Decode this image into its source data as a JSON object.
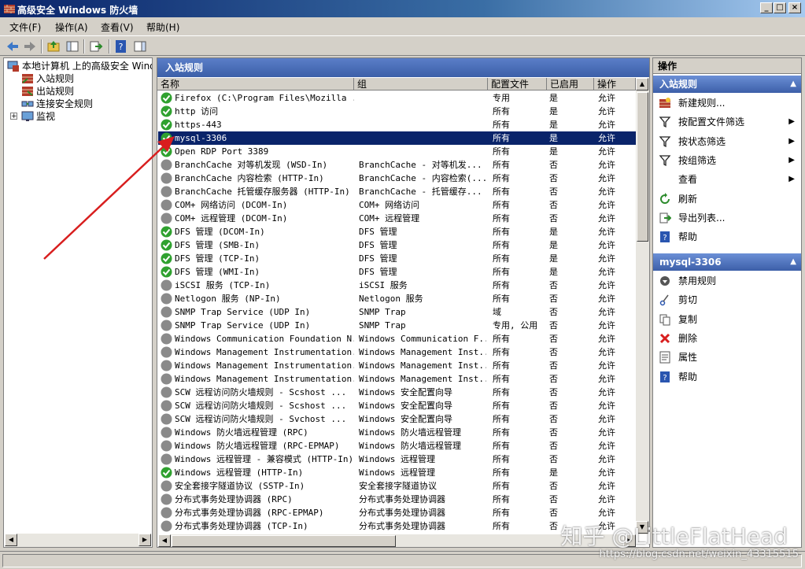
{
  "window": {
    "title": "高级安全 Windows 防火墙",
    "min_glyph": "_",
    "max_glyph": "□",
    "close_glyph": "×"
  },
  "menu": [
    "文件(F)",
    "操作(A)",
    "查看(V)",
    "帮助(H)"
  ],
  "tree": {
    "root": "本地计算机 上的高级安全 Windows 防火墙",
    "items": [
      "入站规则",
      "出站规则",
      "连接安全规则",
      "监视"
    ]
  },
  "center": {
    "header": "入站规则",
    "columns": [
      "名称",
      "组",
      "配置文件",
      "已启用",
      "操作"
    ],
    "rows": [
      {
        "name": "Firefox (C:\\Program Files\\Mozilla ...",
        "group": "",
        "profile": "专用",
        "enabled": "是",
        "action": "允许",
        "on": true
      },
      {
        "name": "http 访问",
        "group": "",
        "profile": "所有",
        "enabled": "是",
        "action": "允许",
        "on": true
      },
      {
        "name": "https-443",
        "group": "",
        "profile": "所有",
        "enabled": "是",
        "action": "允许",
        "on": true
      },
      {
        "name": "mysql-3306",
        "group": "",
        "profile": "所有",
        "enabled": "是",
        "action": "允许",
        "on": true,
        "selected": true
      },
      {
        "name": "Open RDP Port 3389",
        "group": "",
        "profile": "所有",
        "enabled": "是",
        "action": "允许",
        "on": true
      },
      {
        "name": "BranchCache 对等机发现 (WSD-In)",
        "group": "BranchCache - 对等机发...",
        "profile": "所有",
        "enabled": "否",
        "action": "允许",
        "on": false
      },
      {
        "name": "BranchCache 内容检索 (HTTP-In)",
        "group": "BranchCache - 内容检索(...",
        "profile": "所有",
        "enabled": "否",
        "action": "允许",
        "on": false
      },
      {
        "name": "BranchCache 托管缓存服务器 (HTTP-In)",
        "group": "BranchCache - 托管缓存...",
        "profile": "所有",
        "enabled": "否",
        "action": "允许",
        "on": false
      },
      {
        "name": "COM+ 网络访问 (DCOM-In)",
        "group": "COM+ 网络访问",
        "profile": "所有",
        "enabled": "否",
        "action": "允许",
        "on": false
      },
      {
        "name": "COM+ 远程管理 (DCOM-In)",
        "group": "COM+ 远程管理",
        "profile": "所有",
        "enabled": "否",
        "action": "允许",
        "on": false
      },
      {
        "name": "DFS 管理 (DCOM-In)",
        "group": "DFS 管理",
        "profile": "所有",
        "enabled": "是",
        "action": "允许",
        "on": true
      },
      {
        "name": "DFS 管理 (SMB-In)",
        "group": "DFS 管理",
        "profile": "所有",
        "enabled": "是",
        "action": "允许",
        "on": true
      },
      {
        "name": "DFS 管理 (TCP-In)",
        "group": "DFS 管理",
        "profile": "所有",
        "enabled": "是",
        "action": "允许",
        "on": true
      },
      {
        "name": "DFS 管理 (WMI-In)",
        "group": "DFS 管理",
        "profile": "所有",
        "enabled": "是",
        "action": "允许",
        "on": true
      },
      {
        "name": "iSCSI 服务 (TCP-In)",
        "group": "iSCSI 服务",
        "profile": "所有",
        "enabled": "否",
        "action": "允许",
        "on": false
      },
      {
        "name": "Netlogon 服务 (NP-In)",
        "group": "Netlogon 服务",
        "profile": "所有",
        "enabled": "否",
        "action": "允许",
        "on": false
      },
      {
        "name": "SNMP Trap Service (UDP In)",
        "group": "SNMP Trap",
        "profile": "域",
        "enabled": "否",
        "action": "允许",
        "on": false
      },
      {
        "name": "SNMP Trap Service (UDP In)",
        "group": "SNMP Trap",
        "profile": "专用, 公用",
        "enabled": "否",
        "action": "允许",
        "on": false
      },
      {
        "name": "Windows Communication Foundation N...",
        "group": "Windows Communication F...",
        "profile": "所有",
        "enabled": "否",
        "action": "允许",
        "on": false
      },
      {
        "name": "Windows Management Instrumentation...",
        "group": "Windows Management Inst...",
        "profile": "所有",
        "enabled": "否",
        "action": "允许",
        "on": false
      },
      {
        "name": "Windows Management Instrumentation...",
        "group": "Windows Management Inst...",
        "profile": "所有",
        "enabled": "否",
        "action": "允许",
        "on": false
      },
      {
        "name": "Windows Management Instrumentation...",
        "group": "Windows Management Inst...",
        "profile": "所有",
        "enabled": "否",
        "action": "允许",
        "on": false
      },
      {
        "name": "SCW 远程访问防火墙规则 - Scshost ...",
        "group": "Windows 安全配置向导",
        "profile": "所有",
        "enabled": "否",
        "action": "允许",
        "on": false
      },
      {
        "name": "SCW 远程访问防火墙规则 - Scshost ...",
        "group": "Windows 安全配置向导",
        "profile": "所有",
        "enabled": "否",
        "action": "允许",
        "on": false
      },
      {
        "name": "SCW 远程访问防火墙规则 - Svchost ...",
        "group": "Windows 安全配置向导",
        "profile": "所有",
        "enabled": "否",
        "action": "允许",
        "on": false
      },
      {
        "name": "Windows 防火墙远程管理 (RPC)",
        "group": "Windows 防火墙远程管理",
        "profile": "所有",
        "enabled": "否",
        "action": "允许",
        "on": false
      },
      {
        "name": "Windows 防火墙远程管理 (RPC-EPMAP)",
        "group": "Windows 防火墙远程管理",
        "profile": "所有",
        "enabled": "否",
        "action": "允许",
        "on": false
      },
      {
        "name": "Windows 远程管理 - 兼容模式 (HTTP-In)",
        "group": "Windows 远程管理",
        "profile": "所有",
        "enabled": "否",
        "action": "允许",
        "on": false
      },
      {
        "name": "Windows 远程管理 (HTTP-In)",
        "group": "Windows 远程管理",
        "profile": "所有",
        "enabled": "是",
        "action": "允许",
        "on": true
      },
      {
        "name": "安全套接字隧道协议 (SSTP-In)",
        "group": "安全套接字隧道协议",
        "profile": "所有",
        "enabled": "否",
        "action": "允许",
        "on": false
      },
      {
        "name": "分布式事务处理协调器 (RPC)",
        "group": "分布式事务处理协调器",
        "profile": "所有",
        "enabled": "否",
        "action": "允许",
        "on": false
      },
      {
        "name": "分布式事务处理协调器 (RPC-EPMAP)",
        "group": "分布式事务处理协调器",
        "profile": "所有",
        "enabled": "否",
        "action": "允许",
        "on": false
      },
      {
        "name": "分布式事务处理协调器 (TCP-In)",
        "group": "分布式事务处理协调器",
        "profile": "所有",
        "enabled": "否",
        "action": "允许",
        "on": false
      }
    ]
  },
  "actions": {
    "title": "操作",
    "section1": "入站规则",
    "section1_items": [
      {
        "label": "新建规则...",
        "icon": "new-rule-icon",
        "submenu": false
      },
      {
        "label": "按配置文件筛选",
        "icon": "filter-icon",
        "submenu": true
      },
      {
        "label": "按状态筛选",
        "icon": "filter-icon",
        "submenu": true
      },
      {
        "label": "按组筛选",
        "icon": "filter-icon",
        "submenu": true
      },
      {
        "label": "查看",
        "icon": "",
        "submenu": true
      },
      {
        "label": "刷新",
        "icon": "refresh-icon",
        "submenu": false
      },
      {
        "label": "导出列表...",
        "icon": "export-icon",
        "submenu": false
      },
      {
        "label": "帮助",
        "icon": "help-icon",
        "submenu": false
      }
    ],
    "section2": "mysql-3306",
    "section2_items": [
      {
        "label": "禁用规则",
        "icon": "disable-icon"
      },
      {
        "label": "剪切",
        "icon": "cut-icon"
      },
      {
        "label": "复制",
        "icon": "copy-icon"
      },
      {
        "label": "删除",
        "icon": "delete-icon"
      },
      {
        "label": "属性",
        "icon": "properties-icon"
      },
      {
        "label": "帮助",
        "icon": "help-icon"
      }
    ]
  },
  "watermark": {
    "main": "知乎 @LittleFlatHead",
    "sub": "https://blog.csdn.net/weixin_43315515"
  },
  "colors": {
    "selection": "#0a246a",
    "enabled_icon": "#2fa12f",
    "disabled_icon": "#8a8a8a",
    "annotation_arrow": "#d81e1e"
  }
}
